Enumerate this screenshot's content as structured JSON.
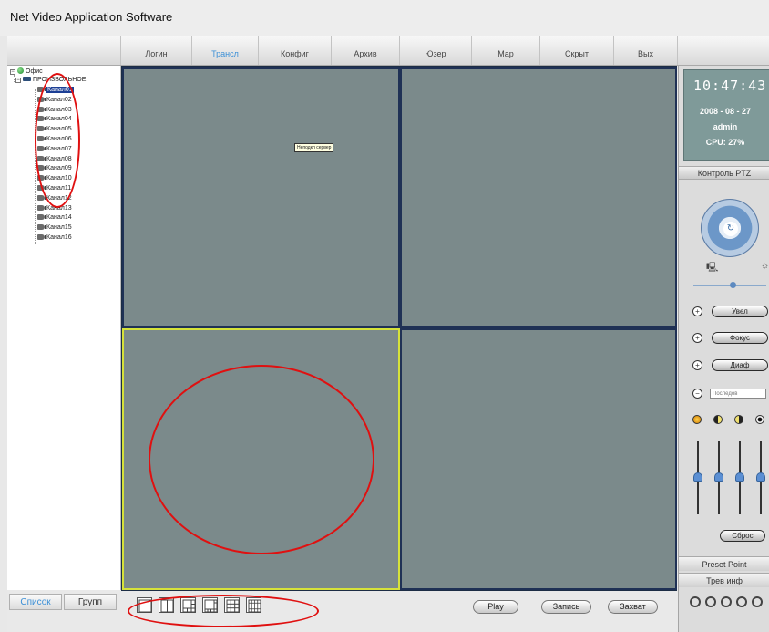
{
  "window": {
    "title": "Net Video Application Software"
  },
  "menu": {
    "items": [
      {
        "label": "Логин"
      },
      {
        "label": "Трансл",
        "active": true
      },
      {
        "label": "Конфиг"
      },
      {
        "label": "Архив"
      },
      {
        "label": "Юзер"
      },
      {
        "label": "Мар"
      },
      {
        "label": "Скрыт"
      },
      {
        "label": "Вых"
      }
    ]
  },
  "tree": {
    "root": "Офис",
    "group": "ПРОИЗВОЛЬНОЕ",
    "channels": [
      "Канал01",
      "Канал02",
      "Канал03",
      "Канал04",
      "Канал05",
      "Канал06",
      "Канал07",
      "Канал08",
      "Канал09",
      "Канал10",
      "Канал11",
      "Канал12",
      "Канал13",
      "Канал14",
      "Канал15",
      "Канал16"
    ],
    "selected_channel": "Канал01"
  },
  "left_tabs": {
    "list_label": "Список",
    "group_label": "Групп"
  },
  "video": {
    "tooltip": "Неподкл сервер",
    "active_pane": 3
  },
  "bottom": {
    "play_label": "Play",
    "record_label": "Запись",
    "capture_label": "Захват"
  },
  "status": {
    "time": "10:47:43",
    "date": "2008 - 08 - 27",
    "user": "admin",
    "cpu": "CPU: 27%"
  },
  "ptz": {
    "title": "Контроль PTZ",
    "zoom_label": "Увел",
    "focus_label": "Фокус",
    "iris_label": "Диаф",
    "preset_placeholder": "Последов",
    "reset_label": "Сброс"
  },
  "footer": {
    "preset_point": "Preset Point",
    "alarm_info": "Трев инф"
  },
  "colors": {
    "pane_bg": "#7b8a8b",
    "pane_border": "#1f3155",
    "active_pane_border": "#d6e23a",
    "annotation": "#e01010",
    "clock_bg": "#7f9a99"
  }
}
